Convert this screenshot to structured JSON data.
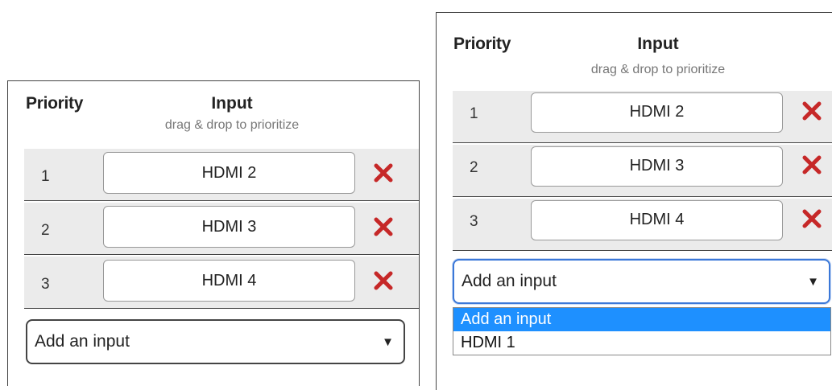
{
  "panels": [
    {
      "header": {
        "priority": "Priority",
        "input": "Input",
        "hint": "drag & drop to prioritize"
      },
      "rows": [
        {
          "num": "1",
          "label": "HDMI 2"
        },
        {
          "num": "2",
          "label": "HDMI 3"
        },
        {
          "num": "3",
          "label": "HDMI 4"
        }
      ],
      "select": {
        "value": "Add an input",
        "arrow": "▼"
      }
    },
    {
      "header": {
        "priority": "Priority",
        "input": "Input",
        "hint": "drag & drop to prioritize"
      },
      "rows": [
        {
          "num": "1",
          "label": "HDMI 2"
        },
        {
          "num": "2",
          "label": "HDMI 3"
        },
        {
          "num": "3",
          "label": "HDMI 4"
        }
      ],
      "select": {
        "value": "Add an input",
        "arrow": "▼"
      },
      "dropdown_options": [
        "Add an input",
        "HDMI 1"
      ],
      "dropdown_selected": "Add an input"
    }
  ],
  "icons": {
    "delete": "close-x-icon",
    "dropdown": "chevron-down-icon"
  },
  "colors": {
    "delete_icon": "#c62828",
    "row_bg": "#ebebeb",
    "selected_option": "#1e90ff",
    "focus_border": "#3b78d8"
  }
}
